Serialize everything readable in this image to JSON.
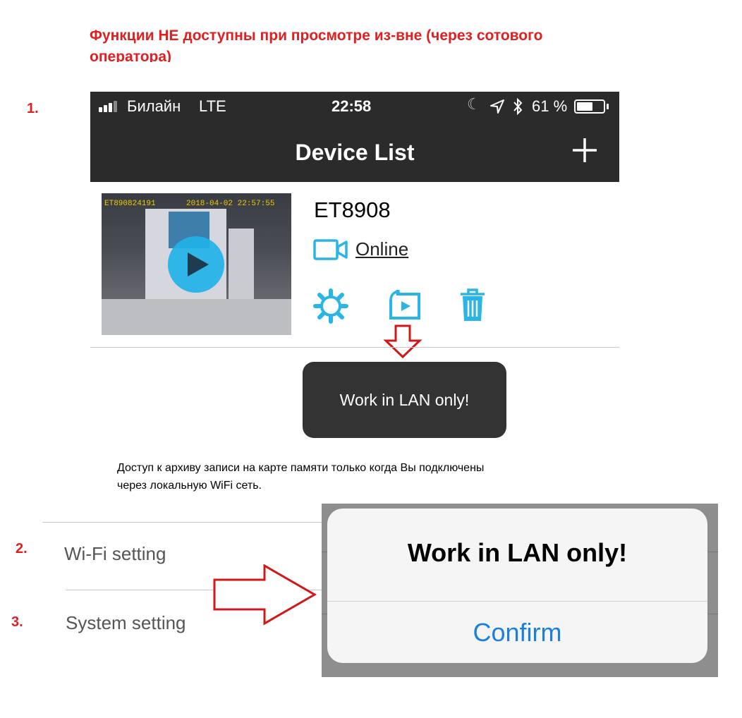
{
  "heading": "Функции НЕ доступны при просмотре из-вне (через сотового оператора)",
  "markers": {
    "one": "1.",
    "two": "2.",
    "three": "3."
  },
  "statusbar": {
    "carrier": "Билайн",
    "network": "LTE",
    "time": "22:58",
    "battery": "61 %",
    "battery_level": 0.61
  },
  "navbar": {
    "title": "Device List"
  },
  "device": {
    "name": "ET8908",
    "status": "Online",
    "thumb_id": "ET890824191",
    "thumb_timestamp": "2018-04-02 22:57:55"
  },
  "toast": {
    "text": "Work in LAN only!"
  },
  "note": {
    "line1": "Доступ к архиву записи на карте памяти только когда Вы подключены",
    "line2": "через локальную WiFi сеть."
  },
  "settings": {
    "wifi": "Wi-Fi setting",
    "system": "System setting"
  },
  "alert": {
    "title": "Work in LAN only!",
    "confirm": "Confirm"
  },
  "colors": {
    "accent": "#29b6e6",
    "annotation_red": "#e02020",
    "bar": "#2b2b2b",
    "confirm_blue": "#1a7fe0"
  }
}
